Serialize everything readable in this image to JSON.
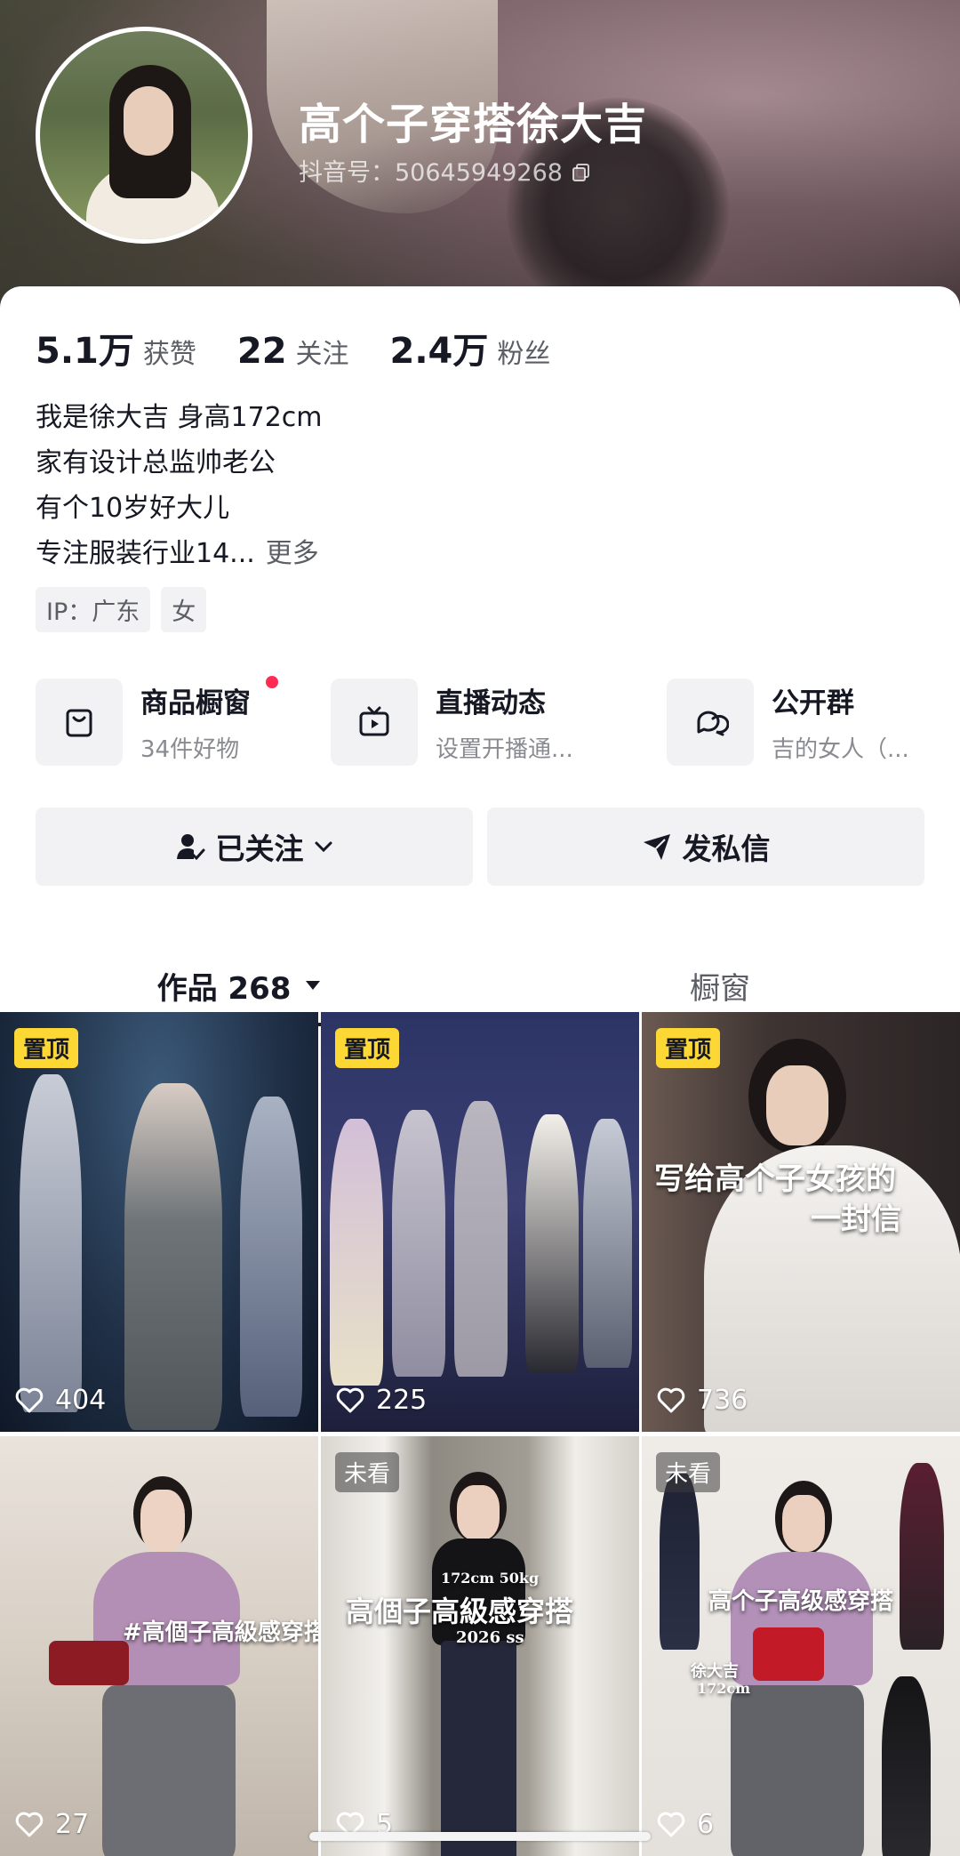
{
  "profile": {
    "name": "高个子穿搭徐大吉",
    "douyin_id": "抖音号：50645949268"
  },
  "stats": [
    {
      "value": "5.1万",
      "label": "获赞"
    },
    {
      "value": "22",
      "label": "关注"
    },
    {
      "value": "2.4万",
      "label": "粉丝"
    }
  ],
  "bio": {
    "lines": [
      "我是徐大吉 身高172cm",
      "家有设计总监帅老公",
      "有个10岁好大儿",
      "专注服装行业14..."
    ],
    "more": "更多"
  },
  "tags": [
    "IP：广东",
    "女"
  ],
  "features": [
    {
      "title": "商品橱窗",
      "subtitle": "34件好物",
      "icon": "shopping-bag-icon",
      "has_dot": true
    },
    {
      "title": "直播动态",
      "subtitle": "设置开播通...",
      "icon": "tv-icon",
      "has_dot": false
    },
    {
      "title": "公开群",
      "subtitle": "吉的女人（...",
      "icon": "chat-bubbles-icon",
      "has_dot": false
    }
  ],
  "actions": {
    "follow_label": "已关注",
    "message_label": "发私信"
  },
  "tabs": {
    "works_label": "作品 268",
    "showcase_label": "橱窗"
  },
  "videos": [
    {
      "badge": "置顶",
      "badge_type": "pinned",
      "likes": "404",
      "overlay": ""
    },
    {
      "badge": "置顶",
      "badge_type": "pinned",
      "likes": "225",
      "overlay": ""
    },
    {
      "badge": "置顶",
      "badge_type": "pinned",
      "likes": "736",
      "overlay": "写给高个子女孩的",
      "overlay2": "一封信"
    },
    {
      "badge": "",
      "badge_type": "none",
      "likes": "27",
      "overlay": "#高個子高級感穿搭"
    },
    {
      "badge": "未看",
      "badge_type": "unseen",
      "likes": "5",
      "overlay": "高個子高級感穿搭",
      "overlay_small": "172cm 50kg",
      "overlay_small2": "2026 ss"
    },
    {
      "badge": "未看",
      "badge_type": "unseen",
      "likes": "6",
      "overlay": "高个子高级感穿搭",
      "overlay_small": "徐大吉",
      "overlay_small2": "172cm"
    }
  ],
  "colors": {
    "accent_red": "#fe2c55",
    "pinned_yellow": "#fdd835",
    "text_primary": "#161823",
    "text_secondary": "#5c5e66"
  }
}
